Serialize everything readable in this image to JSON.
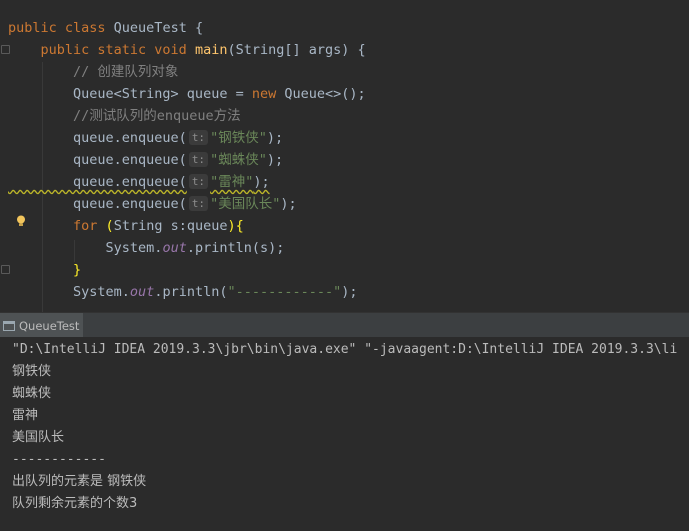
{
  "editor": {
    "lines": [
      [
        {
          "t": "public class ",
          "c": "kw"
        },
        {
          "t": "QueueTest {",
          "c": ""
        }
      ],
      [
        {
          "t": "    public static void ",
          "c": "kw"
        },
        {
          "t": "main",
          "c": "fn"
        },
        {
          "t": "(String[] args) {",
          "c": ""
        }
      ],
      [
        {
          "t": "        // 创建队列对象",
          "c": "cmt"
        }
      ],
      [
        {
          "t": "        Queue<String> queue = ",
          "c": ""
        },
        {
          "t": "new ",
          "c": "kw"
        },
        {
          "t": "Queue<>();",
          "c": ""
        }
      ],
      [
        {
          "t": "        //测试队列的enqueue方法",
          "c": "cmt"
        }
      ],
      [
        {
          "t": "        queue.enqueue(",
          "c": ""
        },
        {
          "t": "t:",
          "c": "hint"
        },
        {
          "t": "\"钢铁侠\"",
          "c": "str"
        },
        {
          "t": ");",
          "c": ""
        }
      ],
      [
        {
          "t": "        queue.enqueue(",
          "c": ""
        },
        {
          "t": "t:",
          "c": "hint"
        },
        {
          "t": "\"蜘蛛侠\"",
          "c": "str"
        },
        {
          "t": ");",
          "c": ""
        }
      ],
      [
        {
          "t": "        queue.enqueue(",
          "c": "squiggle"
        },
        {
          "t": "t:",
          "c": "hint"
        },
        {
          "t": "\"雷神\"",
          "c": "str squiggle"
        },
        {
          "t": ");",
          "c": "squiggle"
        }
      ],
      [
        {
          "t": "        queue.enqueue(",
          "c": ""
        },
        {
          "t": "t:",
          "c": "hint"
        },
        {
          "t": "\"美国队长\"",
          "c": "str"
        },
        {
          "t": ");",
          "c": ""
        }
      ],
      [
        {
          "t": "        for ",
          "c": "kw"
        },
        {
          "t": "(",
          "c": "brace"
        },
        {
          "t": "String s:queue",
          "c": ""
        },
        {
          "t": "){",
          "c": "brace"
        }
      ],
      [
        {
          "t": "            System.",
          "c": ""
        },
        {
          "t": "out",
          "c": "stat"
        },
        {
          "t": ".println(s);",
          "c": ""
        }
      ],
      [
        {
          "t": "        }",
          "c": "brace"
        }
      ],
      [
        {
          "t": "        System.",
          "c": ""
        },
        {
          "t": "out",
          "c": "stat"
        },
        {
          "t": ".println(",
          "c": ""
        },
        {
          "t": "\"------------\"",
          "c": "str"
        },
        {
          "t": ");",
          "c": ""
        }
      ]
    ]
  },
  "run_panel": {
    "tab_label": "QueueTest"
  },
  "console": {
    "lines": [
      "\"D:\\IntelliJ IDEA 2019.3.3\\jbr\\bin\\java.exe\" \"-javaagent:D:\\IntelliJ IDEA 2019.3.3\\li",
      "钢铁侠",
      "蜘蛛侠",
      "雷神",
      "美国队长",
      "------------",
      "出队列的元素是 钢铁侠",
      "队列剩余元素的个数3"
    ]
  },
  "icons": {
    "bulb": "lightbulb-icon",
    "run": "run-icon"
  }
}
